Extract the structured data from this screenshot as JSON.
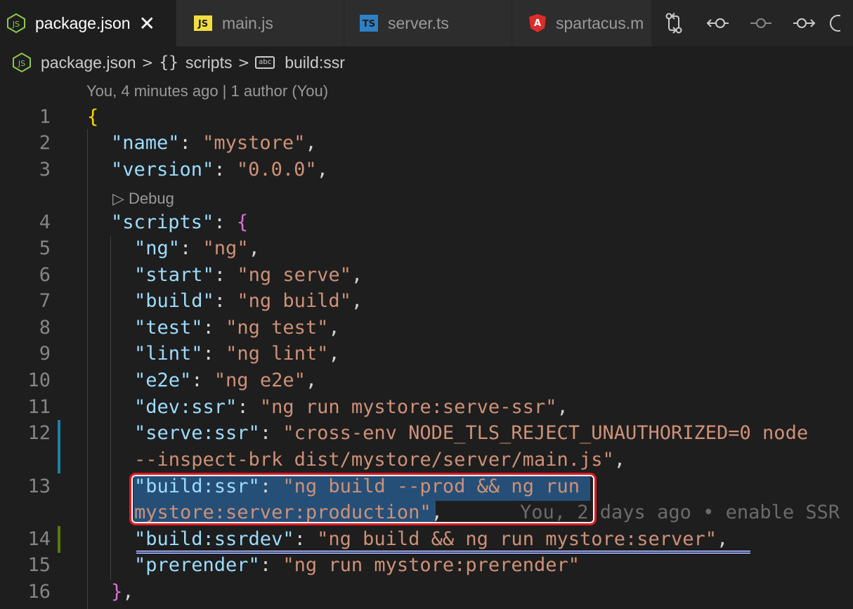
{
  "tabs": [
    {
      "label": "package.json",
      "icon": "nodejs-icon",
      "active": true,
      "close": "✕"
    },
    {
      "label": "main.js",
      "icon": "javascript-icon",
      "badge": "JS"
    },
    {
      "label": "server.ts",
      "icon": "typescript-icon",
      "badge": "TS"
    },
    {
      "label": "spartacus.m",
      "icon": "angular-icon"
    }
  ],
  "breadcrumb": {
    "file": "package.json",
    "scope": "scripts",
    "scope_glyph": "{}",
    "property": "build:ssr",
    "property_badge": "abc",
    "separator": ">"
  },
  "blame_header": "You, 4 minutes ago | 1 author (You)",
  "codelens": "▷ Debug",
  "inline_blame": "You, 2 days ago • enable SSR",
  "line_numbers": [
    "1",
    "2",
    "3",
    "4",
    "5",
    "6",
    "7",
    "8",
    "9",
    "10",
    "11",
    "12",
    "13",
    "14",
    "15",
    "16"
  ],
  "code": {
    "l1_brace": "{",
    "l2_key": "\"name\"",
    "l2_val": "\"mystore\"",
    "l3_key": "\"version\"",
    "l3_val": "\"0.0.0\"",
    "l4_key": "\"scripts\"",
    "l4_brace": "{",
    "l5_key": "\"ng\"",
    "l5_val": "\"ng\"",
    "l6_key": "\"start\"",
    "l6_val": "\"ng serve\"",
    "l7_key": "\"build\"",
    "l7_val": "\"ng build\"",
    "l8_key": "\"test\"",
    "l8_val": "\"ng test\"",
    "l9_key": "\"lint\"",
    "l9_val": "\"ng lint\"",
    "l10_key": "\"e2e\"",
    "l10_val": "\"ng e2e\"",
    "l11_key": "\"dev:ssr\"",
    "l11_val": "\"ng run mystore:serve-ssr\"",
    "l12_key": "\"serve:ssr\"",
    "l12_val_a": "\"cross-env NODE_TLS_REJECT_UNAUTHORIZED=0 node",
    "l12_val_b": "--inspect-brk dist/mystore/server/main.js\"",
    "l13_key": "\"build:ssr\"",
    "l13_val_a": "\"ng build --prod && ng run",
    "l13_val_b": "mystore:server:production\"",
    "l14_key": "\"build:ssrdev\"",
    "l14_val": "\"ng build && ng run mystore:server\"",
    "l15_key": "\"prerender\"",
    "l15_val": "\"ng run mystore:prerender\"",
    "l16_brace": "}"
  },
  "colors": {
    "background": "#1e1e1e",
    "key": "#9cdcfe",
    "string": "#ce9178",
    "bracket": "#ffd700",
    "bracket_nested": "#da70d6",
    "selection": "#264f78",
    "highlight_box": "#e01b24",
    "underline": "#1b33b8",
    "modified_gutter": "#1b81a8",
    "added_gutter": "#587c0c"
  }
}
